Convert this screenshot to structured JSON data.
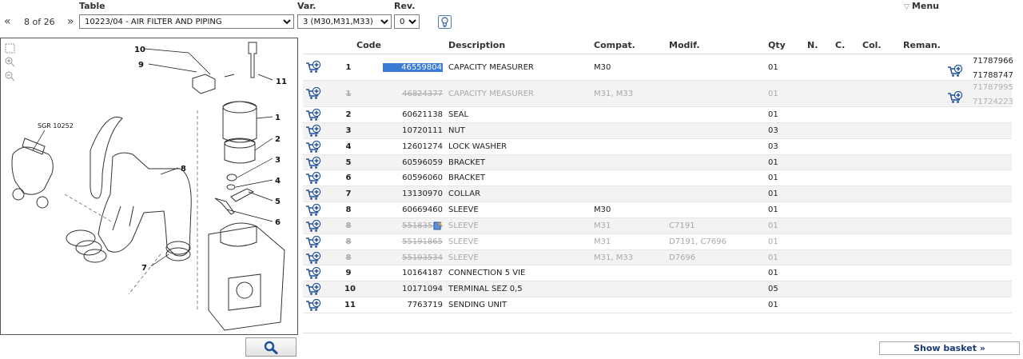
{
  "header": {
    "table_label": "Table",
    "var_label": "Var.",
    "rev_label": "Rev.",
    "menu_label": "Menu"
  },
  "toolbar": {
    "prev": "«",
    "next": "»",
    "page_count": "8 of 26",
    "table_value": "10223/04 - AIR FILTER AND PIPING",
    "var_value": "3 (M30,M31,M33)",
    "rev_value": "0"
  },
  "diagram": {
    "ref_code": "SGR 10252",
    "callouts": [
      "10",
      "9",
      "11",
      "1",
      "2",
      "3",
      "4",
      "5",
      "6",
      "7",
      "8"
    ]
  },
  "columns": {
    "code": "Code",
    "description": "Description",
    "compat": "Compat.",
    "modif": "Modif.",
    "qty": "Qty",
    "n": "N.",
    "c": "C.",
    "col": "Col.",
    "reman": "Reman."
  },
  "rows": [
    {
      "pos": "1",
      "code": "46559804",
      "desc": "CAPACITY MEASURER",
      "compat": "M30",
      "modif": "",
      "qty": "01",
      "reman": [
        "71787966",
        "71788747"
      ]
    },
    {
      "pos": "1",
      "code": "46824377",
      "desc": "CAPACITY MEASURER",
      "compat": "M31, M33",
      "modif": "",
      "qty": "01",
      "reman": [
        "71787995",
        "71724223"
      ]
    },
    {
      "pos": "2",
      "code": "60621138",
      "desc": "SEAL",
      "compat": "",
      "modif": "",
      "qty": "01"
    },
    {
      "pos": "3",
      "code": "10720111",
      "desc": "NUT",
      "compat": "",
      "modif": "",
      "qty": "03"
    },
    {
      "pos": "4",
      "code": "12601274",
      "desc": "LOCK WASHER",
      "compat": "",
      "modif": "",
      "qty": "03"
    },
    {
      "pos": "5",
      "code": "60596059",
      "desc": "BRACKET",
      "compat": "",
      "modif": "",
      "qty": "01"
    },
    {
      "pos": "6",
      "code": "60596060",
      "desc": "BRACKET",
      "compat": "",
      "modif": "",
      "qty": "01"
    },
    {
      "pos": "7",
      "code": "13130970",
      "desc": "COLLAR",
      "compat": "",
      "modif": "",
      "qty": "01"
    },
    {
      "pos": "8",
      "code": "60669460",
      "desc": "SLEEVE",
      "compat": "M30",
      "modif": "",
      "qty": "01"
    },
    {
      "pos": "8",
      "code": "55183555",
      "desc": "SLEEVE",
      "compat": "M31",
      "modif": "C7191",
      "qty": "01"
    },
    {
      "pos": "8",
      "code": "55191865",
      "desc": "SLEEVE",
      "compat": "M31",
      "modif": "D7191, C7696",
      "qty": "01"
    },
    {
      "pos": "8",
      "code": "55193534",
      "desc": "SLEEVE",
      "compat": "M31, M33",
      "modif": "D7696",
      "qty": "01"
    },
    {
      "pos": "9",
      "code": "10164187",
      "desc": "CONNECTION 5 VIE",
      "compat": "",
      "modif": "",
      "qty": "01"
    },
    {
      "pos": "10",
      "code": "10171094",
      "desc": "TERMINAL SEZ 0,5",
      "compat": "",
      "modif": "",
      "qty": "05"
    },
    {
      "pos": "11",
      "code": "7763719",
      "desc": "SENDING UNIT",
      "compat": "",
      "modif": "",
      "qty": "01"
    }
  ],
  "footer": {
    "show_basket": "Show basket »"
  },
  "icons": {
    "cart": "cart-add-icon",
    "search": "search-icon",
    "bulb": "lightbulb-icon",
    "zoom_in": "zoom-in-icon",
    "zoom_out": "zoom-out-icon"
  },
  "colors": {
    "highlight": "#3a7bd5",
    "cart_blue": "#1e4f9c",
    "obsolete_text": "#a9a9a9",
    "stripe": "#f3f3f3"
  }
}
